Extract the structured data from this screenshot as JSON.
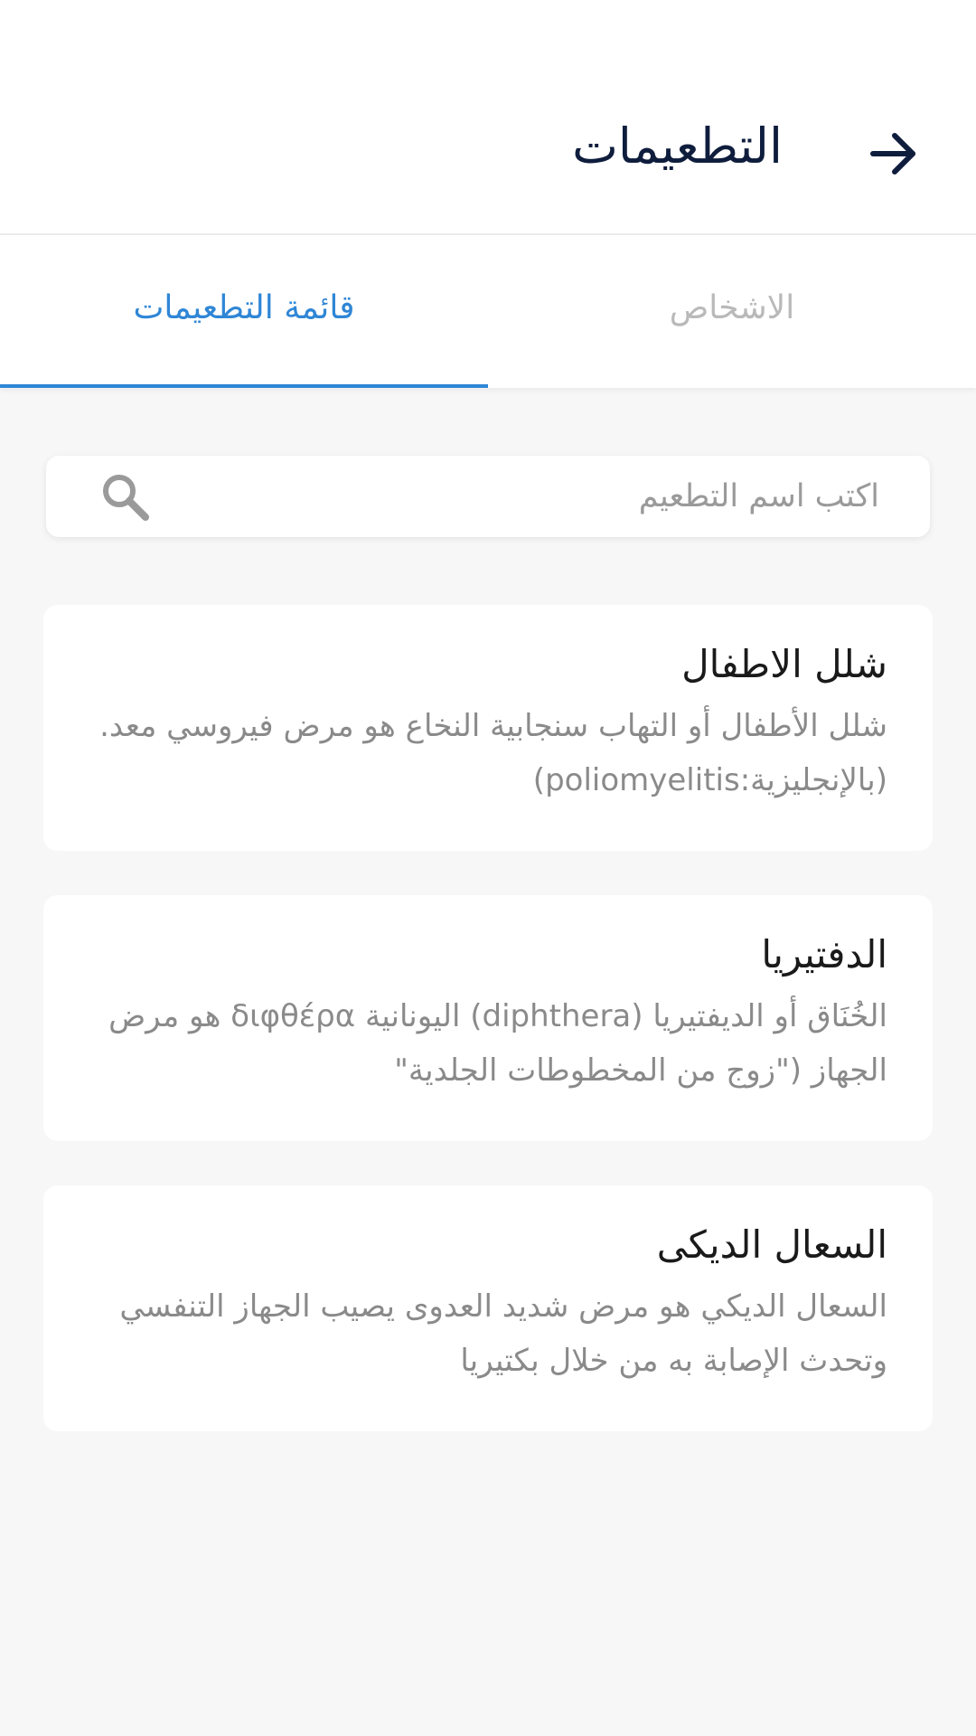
{
  "header": {
    "title": "التطعيمات",
    "back_icon": "arrow-right-icon"
  },
  "tabs": [
    {
      "label": "الاشخاص",
      "active": false
    },
    {
      "label": "قائمة التطعيمات",
      "active": true
    }
  ],
  "search": {
    "placeholder": "اكتب اسم التطعيم",
    "value": "",
    "icon": "search-icon"
  },
  "vaccines": [
    {
      "title": "شلل الاطفال",
      "description": "شلل الأطفال أو التهاب سنجابية النخاع هو مرض فيروسي معد. (بالإنجليزية:poliomyelitis)"
    },
    {
      "title": "الدفتيريا",
      "description": "الخُنَاق أو الديفتيريا (diphthera) اليونانية διφθέρα هو مرض الجهاز (\"زوج من المخطوطات الجلدية\""
    },
    {
      "title": "السعال الديکی",
      "description": "السعال الديكي هو مرض شديد العدوى يصيب الجهاز التنفسي وتحدث الإصابة به من خلال بكتيريا"
    }
  ],
  "colors": {
    "accent": "#2f86d6",
    "title_text": "#0f1d3d",
    "background": "#f7f7f7",
    "inactive_tab": "#b9b9b9"
  }
}
